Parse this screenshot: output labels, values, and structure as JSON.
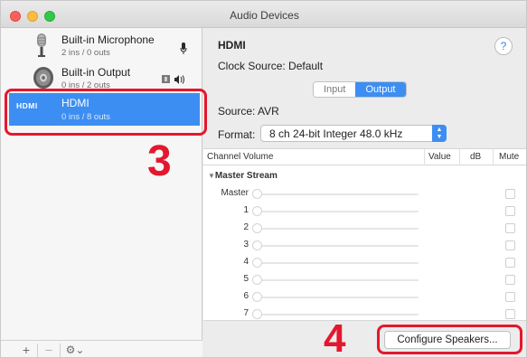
{
  "window": {
    "title": "Audio Devices"
  },
  "sidebar": {
    "devices": [
      {
        "name": "Built-in Microphone",
        "io": "2 ins / 0 outs",
        "icon": "microphone-icon"
      },
      {
        "name": "Built-in Output",
        "io": "0 ins / 2 outs",
        "icon": "speaker-icon"
      },
      {
        "name": "HDMI",
        "io": "0 ins / 8 outs",
        "icon": "hdmi-logo",
        "logo_text": "HDMI",
        "selected": true
      }
    ],
    "toolbar": {
      "add": "+",
      "remove": "−",
      "gear": "⚙︎⌄"
    }
  },
  "detail": {
    "title": "HDMI",
    "help": "?",
    "clock_source": "Clock Source:  Default",
    "tabs": {
      "input": "Input",
      "output": "Output",
      "selected": "Output"
    },
    "source": "Source:  AVR",
    "format_label": "Format:",
    "format_value": "8 ch 24-bit Integer 48.0 kHz",
    "table": {
      "columns": [
        "Channel Volume",
        "Value",
        "dB",
        "Mute"
      ],
      "group": "Master Stream",
      "rows": [
        "Master",
        "1",
        "2",
        "3",
        "4",
        "5",
        "6",
        "7"
      ]
    },
    "configure_button": "Configure Speakers..."
  },
  "annotations": {
    "step3": "3",
    "step4": "4",
    "color": "#e3182e"
  },
  "colors": {
    "accent": "#3d8ef2"
  }
}
